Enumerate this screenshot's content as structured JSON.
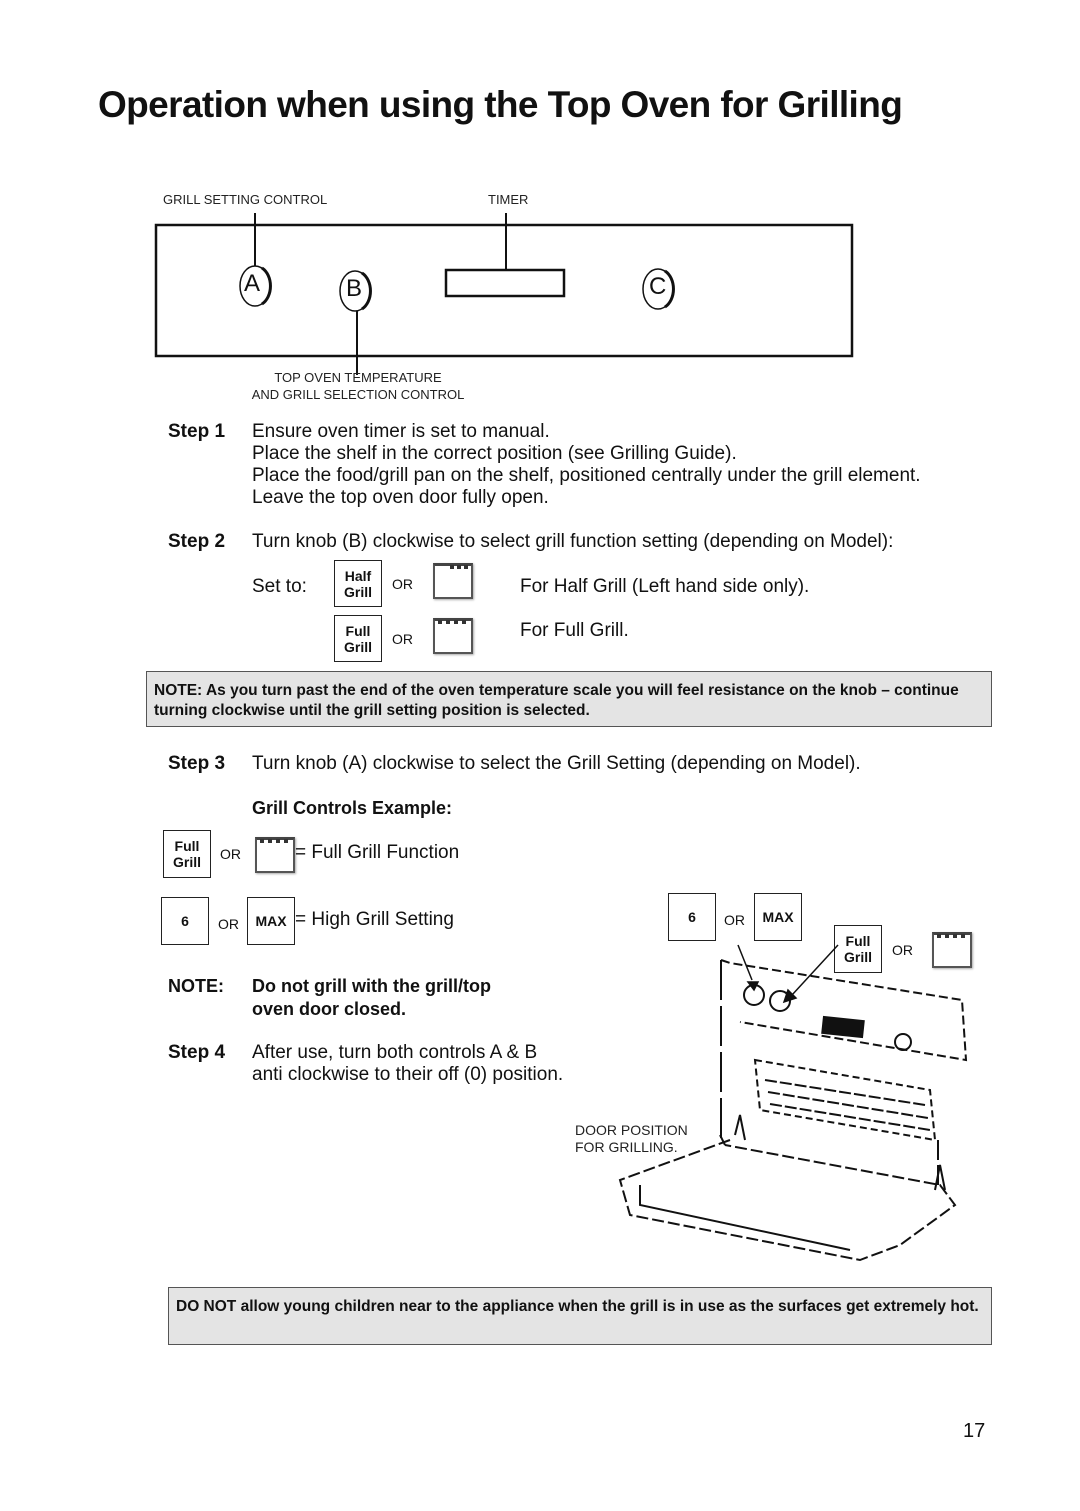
{
  "title": "Operation when using the Top Oven for Grilling",
  "panel": {
    "grill_setting_label": "GRILL SETTING CONTROL",
    "timer_label": "TIMER",
    "knob_a": "A",
    "knob_b": "B",
    "knob_c": "C",
    "top_oven_label_1": "TOP OVEN TEMPERATURE",
    "top_oven_label_2": "AND GRILL SELECTION CONTROL"
  },
  "step1": {
    "label": "Step 1",
    "lines": [
      "Ensure oven timer is set to manual.",
      "Place the shelf in the correct position (see Grilling Guide).",
      "Place the food/grill pan on the shelf, positioned centrally under the grill element.",
      "Leave the top oven door fully open."
    ]
  },
  "step2": {
    "label": "Step 2",
    "text": "Turn knob (B) clockwise to select grill function setting (depending on Model):",
    "set_to": "Set to:",
    "half_grill": "Half Grill",
    "full_grill": "Full Grill",
    "or": "OR",
    "half_desc": "For Half Grill (Left hand side only).",
    "full_desc": "For Full Grill.",
    "half_icon": "half-grill-symbol",
    "full_icon": "full-grill-symbol"
  },
  "note1": "NOTE: As you turn past the end of the oven temperature scale you will feel resistance on the knob – continue turning clockwise until the grill setting position is selected.",
  "step3": {
    "label": "Step 3",
    "text": "Turn knob (A) clockwise to select the Grill Setting (depending on Model).",
    "example_heading": "Grill Controls Example:",
    "full_grill": "Full Grill",
    "or": "OR",
    "full_function": "= Full Grill Function",
    "six": "6",
    "max": "MAX",
    "high_setting": "= High Grill Setting"
  },
  "note2": {
    "label": "NOTE:",
    "text_1": "Do not grill with the grill/top",
    "text_2": "oven door closed."
  },
  "step4": {
    "label": "Step 4",
    "lines": [
      "After use, turn both controls A & B",
      "anti clockwise to their off (0) position."
    ]
  },
  "illustration": {
    "six": "6",
    "or": "OR",
    "max": "MAX",
    "full_grill": "Full Grill",
    "door_label_1": "DOOR POSITION",
    "door_label_2": "FOR GRILLING."
  },
  "warning": "DO NOT allow young children near to the appliance when the grill is in use as the surfaces get extremely hot.",
  "page_number": "17"
}
